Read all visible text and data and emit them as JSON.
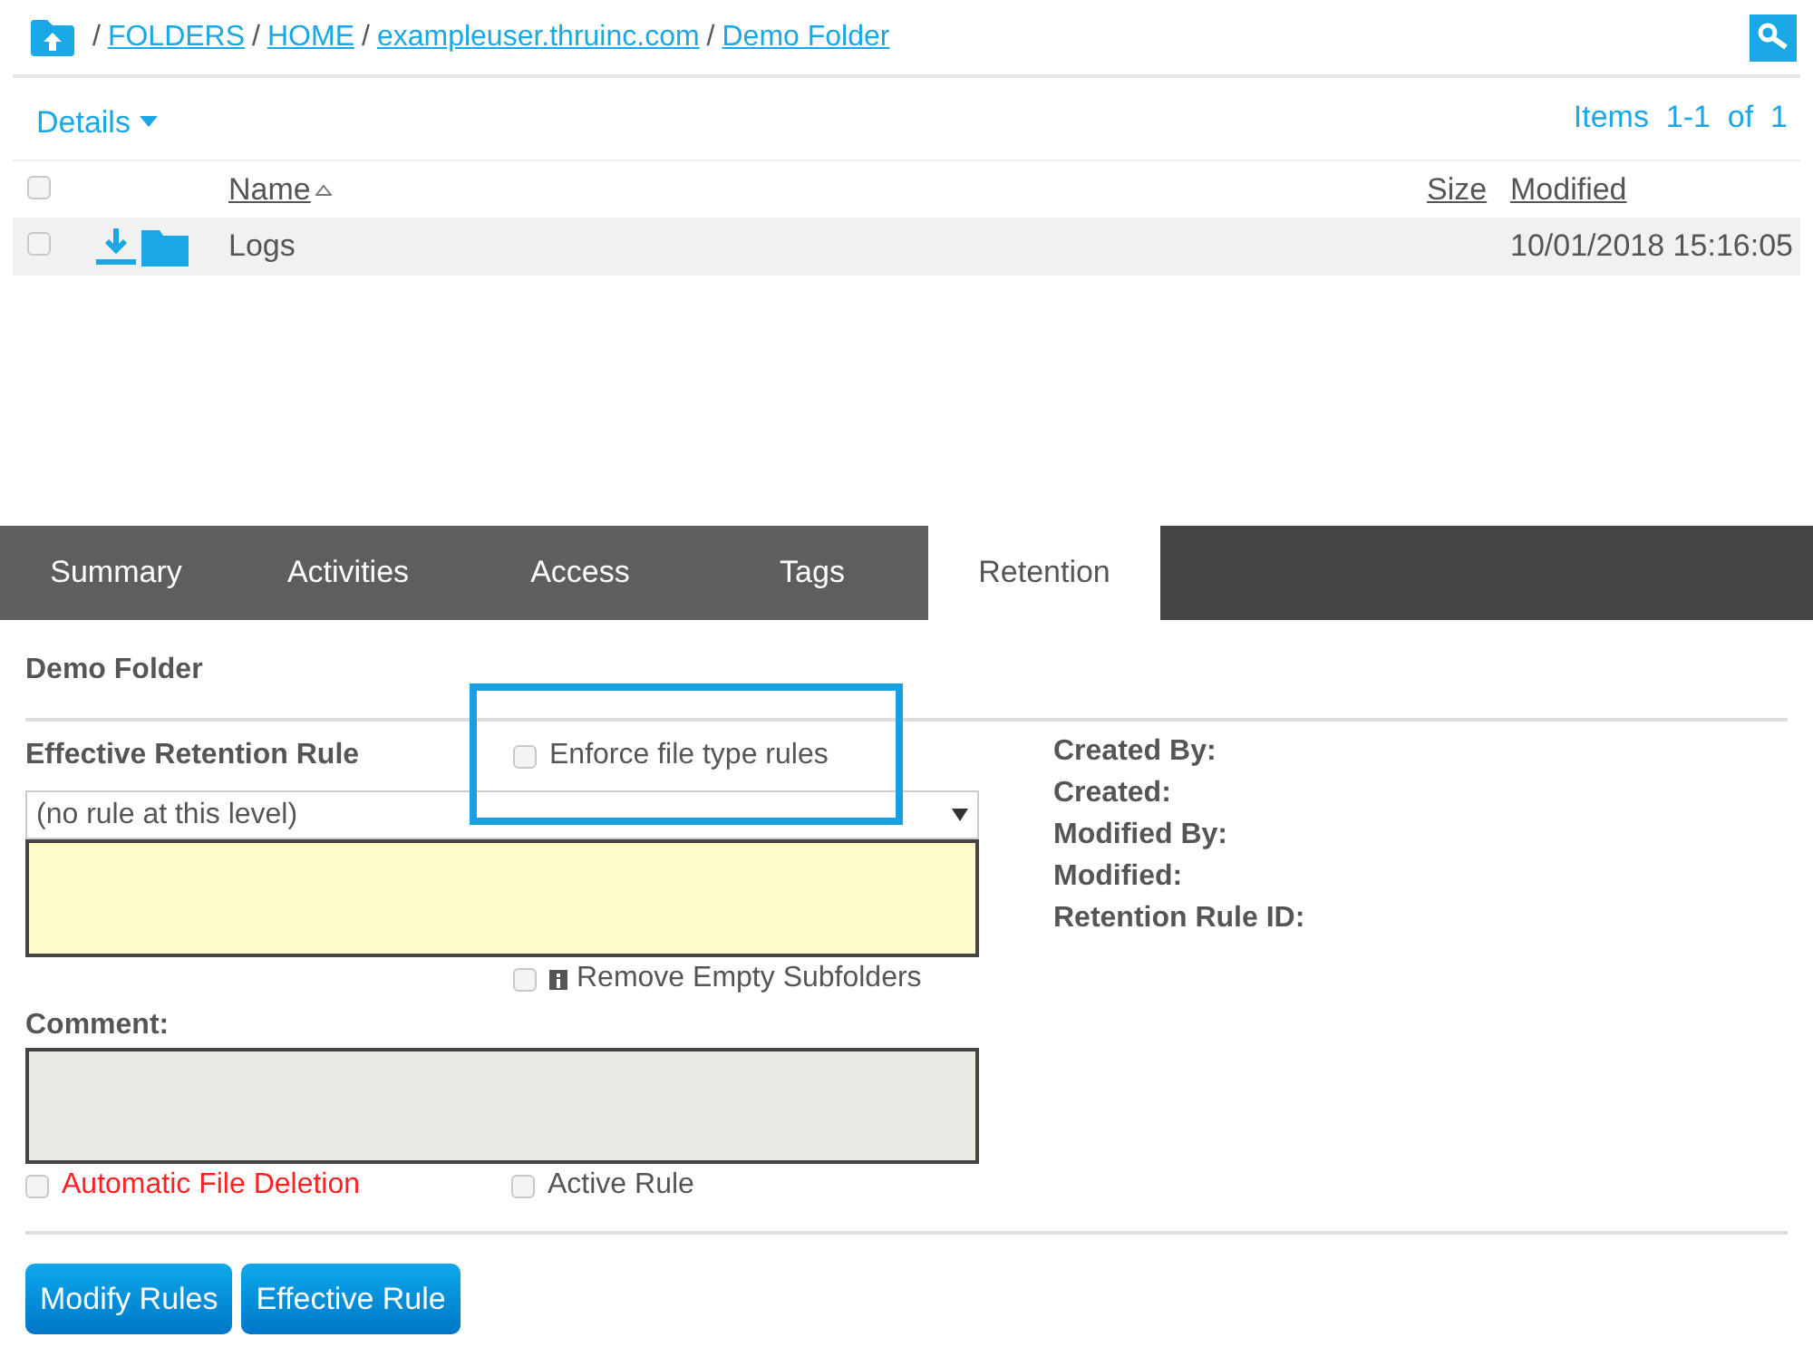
{
  "breadcrumb": [
    {
      "separator": "/",
      "label": "FOLDERS"
    },
    {
      "separator": "/",
      "label": "HOME"
    },
    {
      "separator": "/",
      "label": "exampleuser.thruinc.com"
    },
    {
      "separator": "/",
      "label": "Demo Folder"
    }
  ],
  "view_menu": "Details",
  "pagination": {
    "label": "Items",
    "range": "1-1",
    "of": "of",
    "total": "1"
  },
  "table": {
    "select_all": {
      "checked": false
    },
    "columns": [
      {
        "label": "Name",
        "sorted": true
      },
      {
        "label": "Size",
        "sorted": false
      },
      {
        "label": "Modified",
        "sorted": false
      }
    ],
    "rows": [
      {
        "checked": false,
        "name": "Logs",
        "size": "",
        "modified": "10/01/2018 15:16:05"
      }
    ]
  },
  "tabs": [
    {
      "label": "Summary",
      "selected": false
    },
    {
      "label": "Activities",
      "selected": false
    },
    {
      "label": "Access",
      "selected": false
    },
    {
      "label": "Tags",
      "selected": false
    },
    {
      "label": "Retention",
      "selected": true
    }
  ],
  "panel": {
    "title": "Demo Folder",
    "rule_label": "Effective Retention Rule",
    "enforce": {
      "label": "Enforce file type rules",
      "checked": false,
      "highlighted": true
    },
    "rule_select": "(no rule at this level)",
    "remove_empty": {
      "label": "Remove Empty Subfolders",
      "checked": false
    },
    "comment_label": "Comment:",
    "auto_delete": {
      "label": "Automatic File Deletion",
      "checked": false
    },
    "active_rule": {
      "label": "Active Rule",
      "checked": false
    },
    "info": [
      "Created By:",
      "Created:",
      "Modified By:",
      "Modified:",
      "Retention Rule ID:"
    ],
    "buttons": [
      "Modify Rules",
      "Effective Rule"
    ]
  }
}
